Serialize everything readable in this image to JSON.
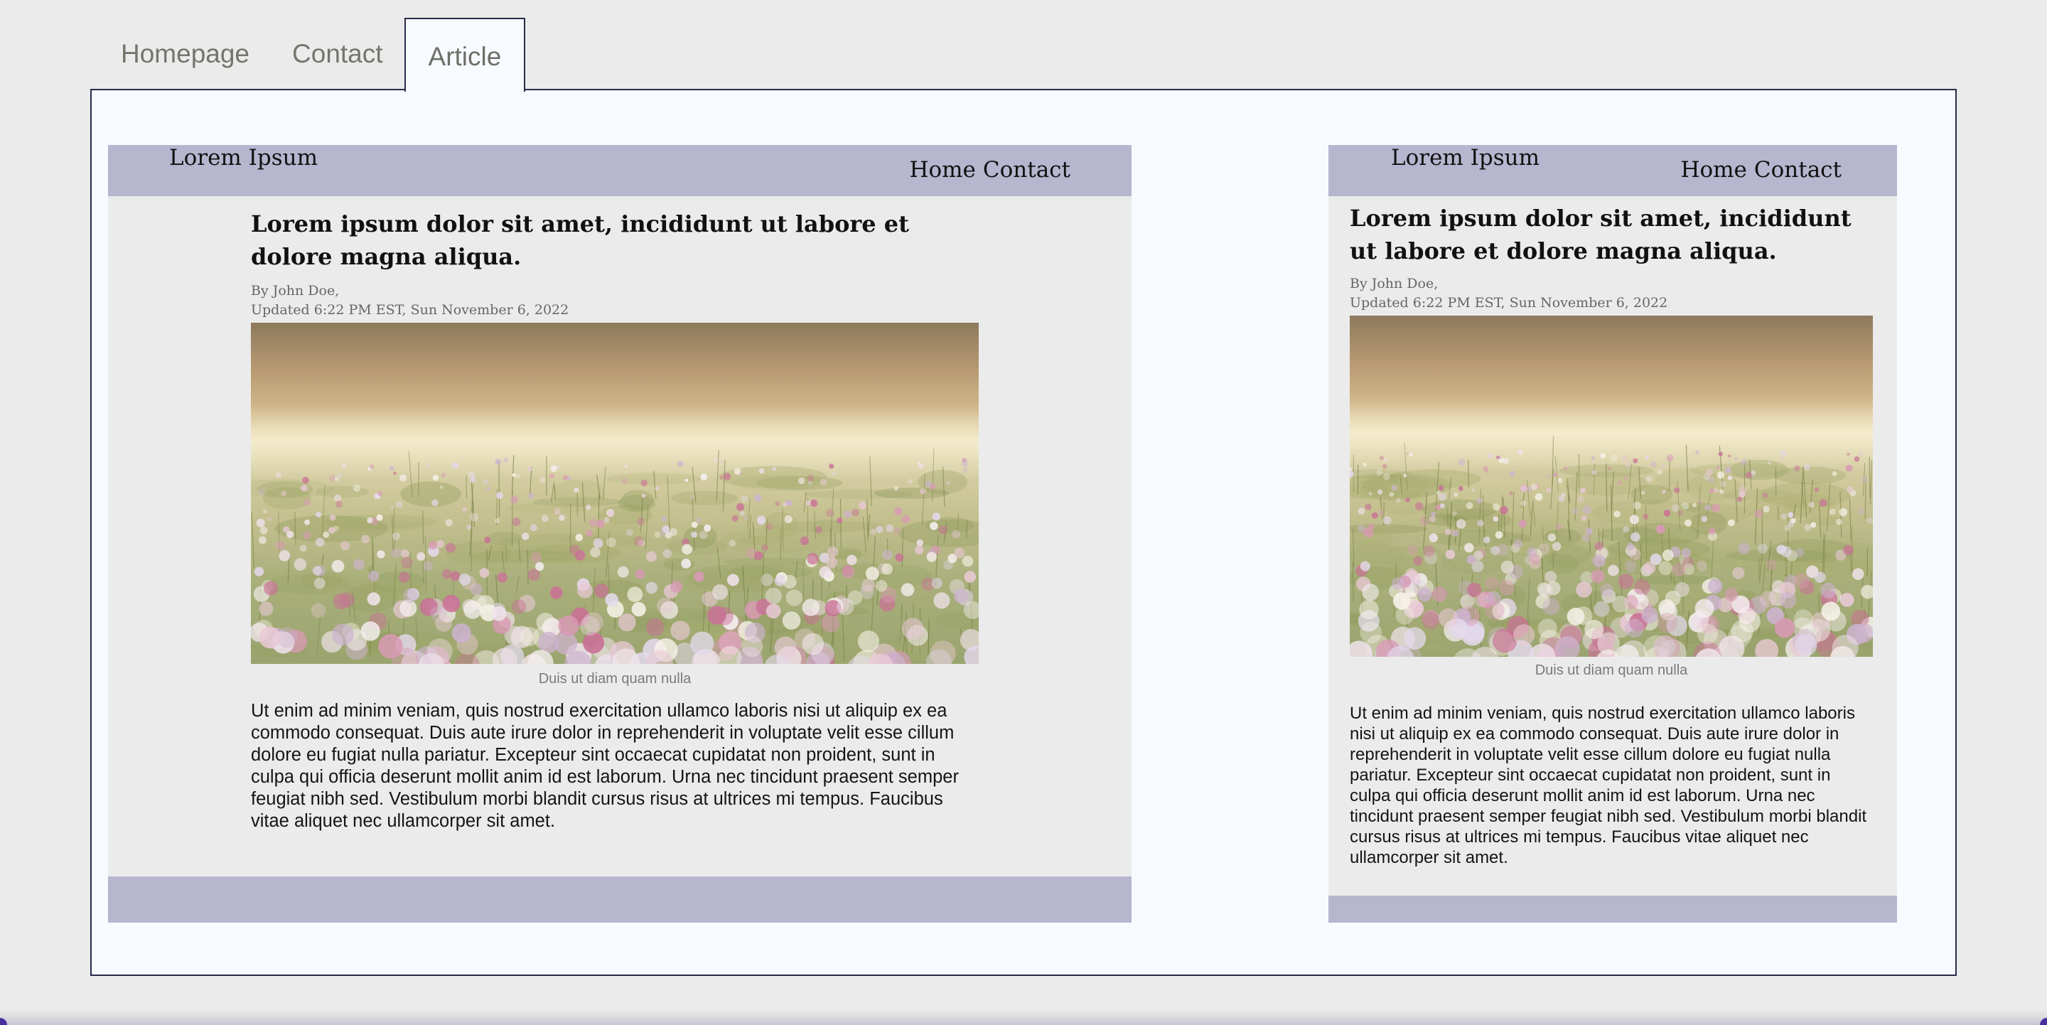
{
  "tabs": [
    {
      "label": "Homepage"
    },
    {
      "label": "Contact"
    },
    {
      "label": "Article",
      "active": true
    }
  ],
  "article": {
    "site_title": "Lorem Ipsum",
    "nav": {
      "home": "Home",
      "contact": "Contact"
    },
    "headline": "Lorem ipsum dolor sit amet, incididunt ut labore et dolore magna aliqua.",
    "byline": "By John Doe,",
    "updated": "Updated 6:22 PM EST, Sun November 6, 2022",
    "image_subject": "pink and white cosmos flower field",
    "caption": "Duis ut diam quam nulla",
    "body": "Ut enim ad minim veniam, quis nostrud exercitation ullamco laboris nisi ut aliquip ex ea commodo consequat. Duis aute irure dolor in reprehenderit in voluptate velit esse cillum dolore eu fugiat nulla pariatur. Excepteur sint occaecat cupidatat non proident, sunt in culpa qui officia deserunt mollit anim id est laborum. Urna nec tincidunt praesent semper feugiat nibh sed. Vestibulum morbi blandit cursus risus at ultrices mi tempus. Faucibus vitae aliquet nec ullamcorper sit amet."
  },
  "colors": {
    "background": "#ebebeb",
    "panel": "#f7fbff",
    "panel_border": "#2a2a4a",
    "header_band": "#b7b6cf",
    "tab_text": "#75756e"
  }
}
